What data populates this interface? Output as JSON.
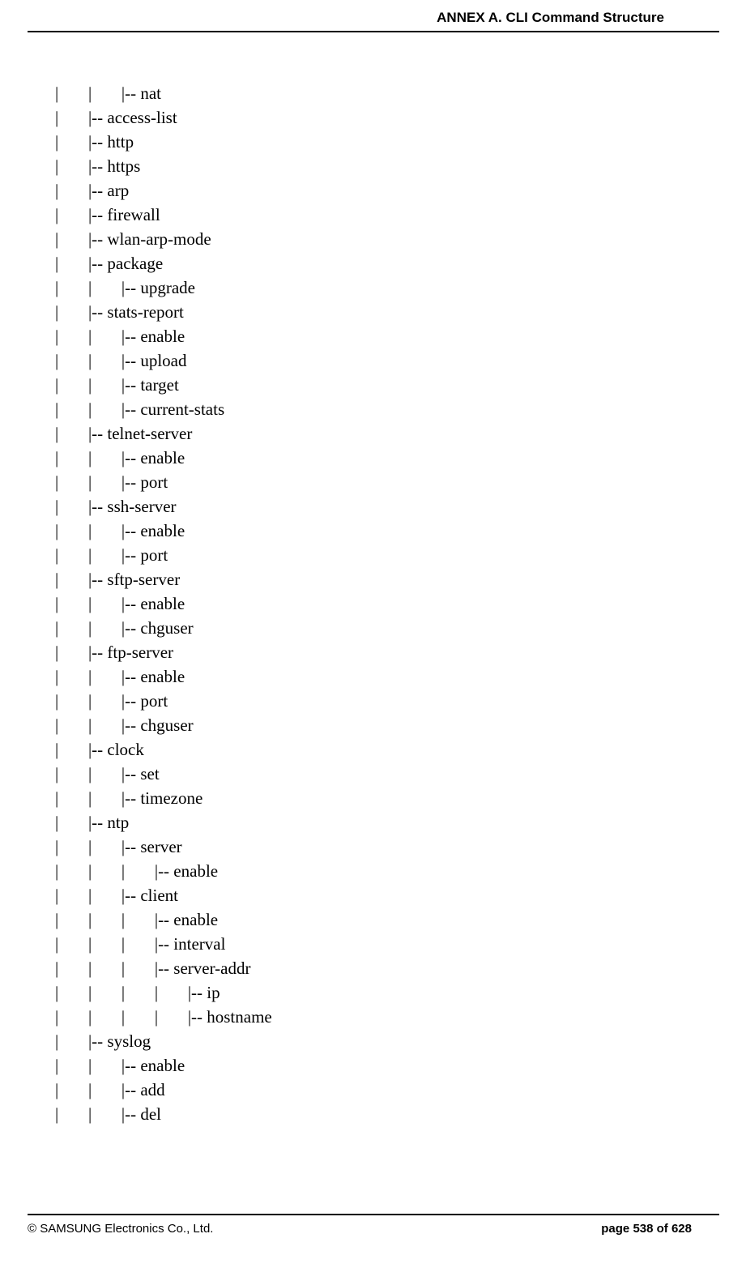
{
  "header": {
    "title": "ANNEX A. CLI Command Structure"
  },
  "tree": {
    "lines": [
      "|       |       |-- nat",
      "|       |-- access-list",
      "|       |-- http",
      "|       |-- https",
      "|       |-- arp",
      "|       |-- firewall",
      "|       |-- wlan-arp-mode",
      "|       |-- package",
      "|       |       |-- upgrade",
      "|       |-- stats-report",
      "|       |       |-- enable",
      "|       |       |-- upload",
      "|       |       |-- target",
      "|       |       |-- current-stats",
      "|       |-- telnet-server",
      "|       |       |-- enable",
      "|       |       |-- port",
      "|       |-- ssh-server",
      "|       |       |-- enable",
      "|       |       |-- port",
      "|       |-- sftp-server",
      "|       |       |-- enable",
      "|       |       |-- chguser",
      "|       |-- ftp-server",
      "|       |       |-- enable",
      "|       |       |-- port",
      "|       |       |-- chguser",
      "|       |-- clock",
      "|       |       |-- set",
      "|       |       |-- timezone",
      "|       |-- ntp",
      "|       |       |-- server",
      "|       |       |       |-- enable",
      "|       |       |-- client",
      "|       |       |       |-- enable",
      "|       |       |       |-- interval",
      "|       |       |       |-- server-addr",
      "|       |       |       |       |-- ip",
      "|       |       |       |       |-- hostname",
      "|       |-- syslog",
      "|       |       |-- enable",
      "|       |       |-- add",
      "|       |       |-- del"
    ]
  },
  "footer": {
    "copyright": "© SAMSUNG Electronics Co., Ltd.",
    "page": "page 538 of 628"
  }
}
